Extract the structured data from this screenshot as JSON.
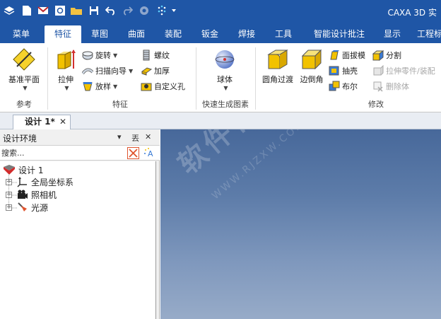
{
  "app": {
    "title": "CAXA 3D 实"
  },
  "quick_access": [
    "layers-icon",
    "new-file-icon",
    "mail-icon",
    "document-icon",
    "open-folder-icon",
    "save-icon",
    "undo-icon",
    "redo-icon",
    "gear-icon",
    "sparkle-grid-icon",
    "dropdown-arrow-icon"
  ],
  "tabs": [
    {
      "label": "菜单",
      "active": false
    },
    {
      "label": "特征",
      "active": true
    },
    {
      "label": "草图",
      "active": false
    },
    {
      "label": "曲面",
      "active": false
    },
    {
      "label": "装配",
      "active": false
    },
    {
      "label": "钣金",
      "active": false
    },
    {
      "label": "焊接",
      "active": false
    },
    {
      "label": "工具",
      "active": false
    },
    {
      "label": "智能设计批注",
      "active": false
    },
    {
      "label": "显示",
      "active": false
    },
    {
      "label": "工程标",
      "active": false
    }
  ],
  "ribbon": {
    "ref_group": {
      "label": "参考",
      "datum_plane": "基准平面"
    },
    "feature_group": {
      "label": "特征",
      "extrude": "拉伸",
      "revolve": "旋转",
      "sweep_guide": "扫描向导",
      "loft": "放样",
      "thread": "螺纹",
      "thicken": "加厚",
      "custom_hole": "自定义孔"
    },
    "quick_group": {
      "label": "快速生成图素",
      "sphere": "球体"
    },
    "modify_group": {
      "label": "修改",
      "fillet": "圆角过渡",
      "chamfer": "边倒角",
      "draft": "面拔模",
      "shell": "抽壳",
      "boolean": "布尔",
      "split": "分割",
      "stretch_part": "拉伸零件/装配",
      "delete_body": "删除体"
    }
  },
  "document": {
    "tab_label": "设计 1*",
    "close": "✕"
  },
  "panel": {
    "title": "设计环境",
    "pin": "▾",
    "autohide": "丟",
    "close": "✕",
    "search_placeholder": "搜索...",
    "tree": [
      {
        "label": "设计 1",
        "icon": "design-icon"
      },
      {
        "label": "全局坐标系",
        "icon": "coordinate-axes-icon"
      },
      {
        "label": "照相机",
        "icon": "camera-icon"
      },
      {
        "label": "光源",
        "icon": "light-source-icon"
      }
    ]
  },
  "watermark": {
    "text": "软件自学网",
    "url": "WWW.RJZXW.COM"
  },
  "colors": {
    "title_bar": "#1f56a6",
    "active_tab_text": "#1f56a6",
    "viewport_top": "#47689a",
    "viewport_bottom": "#97abc8"
  }
}
